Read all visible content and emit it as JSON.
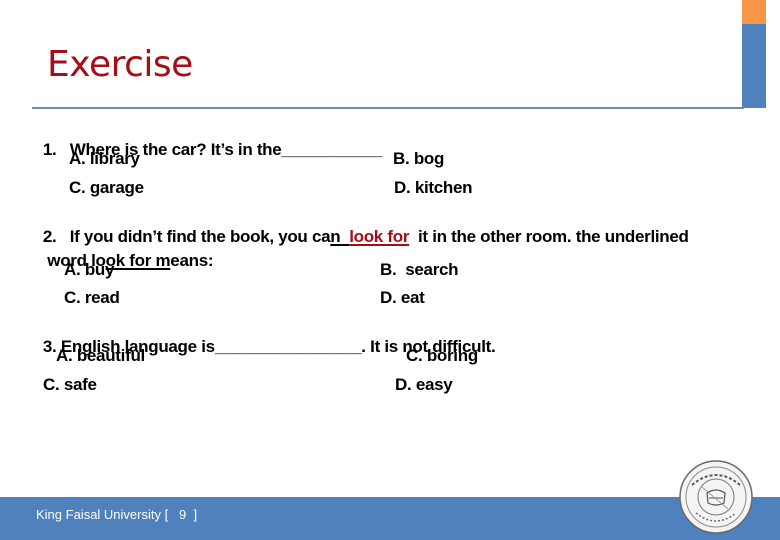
{
  "slide": {
    "title": "Exercise",
    "accent_colors": {
      "orange": "#f79646",
      "blue": "#4f81bd",
      "title_red": "#a50e16"
    }
  },
  "questions": [
    {
      "stem_prefix": "1.   Where is the car? It’s in the",
      "blank": "___________",
      "options": [
        {
          "label": "A. library"
        },
        {
          "label": "B. bog"
        },
        {
          "label": "C. garage"
        },
        {
          "label": "D. kitchen"
        }
      ]
    },
    {
      "stem_part1": "2.   If you didn’t find the book, you ca",
      "stem_underlined_plain": "n  ",
      "stem_highlight": "look for",
      "stem_part2": "  it in the other room. the underlined",
      "line2_prefix": " word lo",
      "line2_underlined": "ok for m",
      "line2_suffix": "eans:",
      "options": [
        {
          "label": "A. buy"
        },
        {
          "label": "B.  search"
        },
        {
          "label": "C. read"
        },
        {
          "label": "D. eat"
        }
      ]
    },
    {
      "stem_prefix": "3. English language is",
      "blank": "________________",
      "stem_suffix": ". It is not difficult.",
      "options": [
        {
          "label": "A. beautiful"
        },
        {
          "label": "C. boring"
        },
        {
          "label": "C. safe"
        },
        {
          "label": "D. easy"
        }
      ]
    }
  ],
  "footer": {
    "text": "King Faisal University [   9  ]",
    "logo": "university-seal-icon"
  }
}
